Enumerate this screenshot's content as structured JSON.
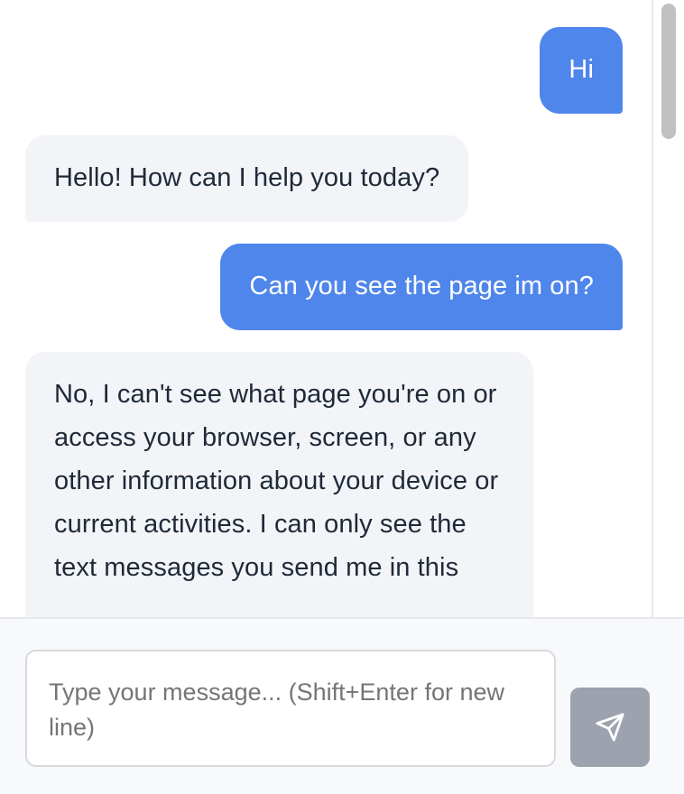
{
  "messages": [
    {
      "role": "user",
      "text": "Hi"
    },
    {
      "role": "assistant",
      "text": "Hello! How can I help you today?"
    },
    {
      "role": "user",
      "text": "Can you see the page im on?"
    },
    {
      "role": "assistant",
      "text": "No, I can't see what page you're on or access your browser, screen, or any other information about your device or current activities. I can only see the text messages you send me in this"
    }
  ],
  "composer": {
    "placeholder": "Type your message... (Shift+Enter for new line)",
    "send_icon": "send-icon"
  },
  "colors": {
    "user_bubble": "#4f86ec",
    "assistant_bubble": "#f2f4f8",
    "send_button_disabled": "#9ca3af"
  }
}
